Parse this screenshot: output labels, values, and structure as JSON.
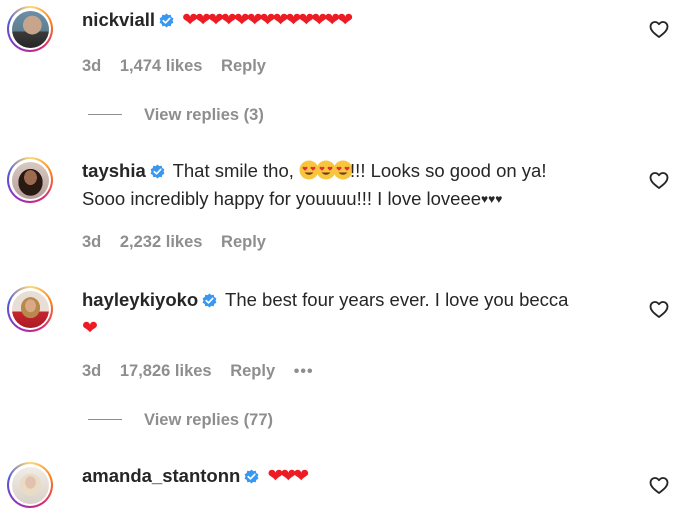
{
  "colors": {
    "heart": "#ed1c24",
    "verified": "#3897f0",
    "meta": "#8e8e8e"
  },
  "comments": [
    {
      "username": "nickviall",
      "text": "",
      "hearts": "❤❤❤❤❤❤❤❤❤❤❤❤❤",
      "age": "3d",
      "likes": "1,474 likes",
      "reply": "Reply",
      "view_replies": "View replies (3)"
    },
    {
      "username": "tayshia",
      "text_before": "That smile tho,",
      "text_after": "!!! Looks so good on ya!",
      "text_line2": "Sooo incredibly happy for youuuu!!! I love loveee",
      "black_hearts": "♥♥♥",
      "emoji": "smiling-face-heart-eyes",
      "age": "3d",
      "likes": "2,232 likes",
      "reply": "Reply"
    },
    {
      "username": "hayleykiyoko",
      "text": "The best four years ever. I love you becca",
      "hearts": "❤",
      "age": "3d",
      "likes": "17,826 likes",
      "reply": "Reply",
      "more": "•••",
      "view_replies": "View replies (77)"
    },
    {
      "username": "amanda_stantonn",
      "hearts": "❤❤❤",
      "age": "",
      "likes": "",
      "reply": ""
    }
  ]
}
